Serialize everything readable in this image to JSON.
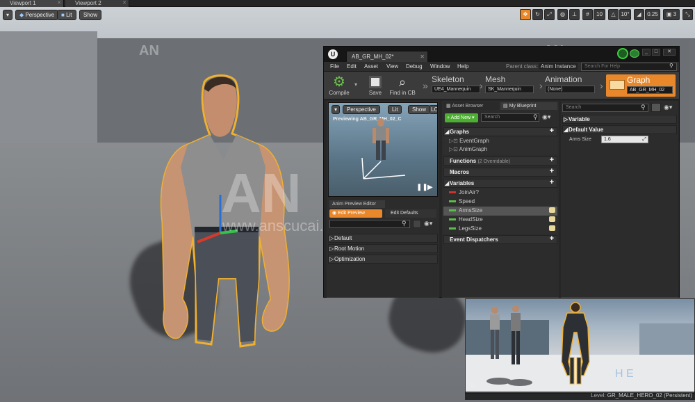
{
  "viewport_tabs": [
    "Viewport 1",
    "Viewport 2"
  ],
  "viewport_toolbar": {
    "perspective": "Perspective",
    "lit": "Lit",
    "show": "Show"
  },
  "viewport_settings": {
    "grid_snap": "10",
    "rot_snap": "10°",
    "scale_snap": "0.25",
    "camera_speed": "3"
  },
  "watermark": {
    "logo": "AN",
    "site": "www.anscucai.com"
  },
  "editor": {
    "doc_tab": "AB_GR_MH_02*",
    "menu": [
      "File",
      "Edit",
      "Asset",
      "View",
      "Debug",
      "Window",
      "Help"
    ],
    "parent_class_label": "Parent class:",
    "parent_class": "Anim Instance",
    "search_help": "Search For Help",
    "tools": {
      "compile": "Compile",
      "save": "Save",
      "find_in_cb": "Find in CB"
    },
    "breadcrumbs": [
      {
        "label": "Skeleton",
        "value": "UE4_Mannequin"
      },
      {
        "label": "Mesh",
        "value": "SK_Mannequin"
      },
      {
        "label": "Animation",
        "value": "(None)"
      },
      {
        "label": "Graph",
        "value": "AB_GR_MH_02"
      }
    ],
    "preview": {
      "perspective": "Perspective",
      "lit": "Lit",
      "show": "Show",
      "extra": "LO",
      "previewing": "Previewing AB_GR_MH_02_C",
      "anim_preview_editor": "Anim Preview Editor",
      "edit_preview": "Edit Preview",
      "edit_defaults": "Edit Defaults",
      "sections": [
        "Default",
        "Root Motion",
        "Optimization"
      ]
    },
    "my_blueprint": {
      "tabs": [
        "Asset Browser",
        "My Blueprint"
      ],
      "add_new": "Add New",
      "search_placeholder": "Search",
      "graphs_header": "Graphs",
      "graphs": [
        "EventGraph",
        "AnimGraph"
      ],
      "functions_header": "Functions",
      "functions_count": "(2 Overridable)",
      "macros_header": "Macros",
      "variables_header": "Variables",
      "variables": [
        "JoinAir?",
        "Speed",
        "ArmsSize",
        "HeadSize",
        "LegsSize"
      ],
      "dispatchers_header": "Event Dispatchers"
    },
    "details": {
      "search_placeholder": "Search",
      "variable_header": "Variable",
      "default_value_header": "Default Value",
      "property_label": "Arms Size",
      "property_value": "1.6"
    }
  },
  "status": {
    "level_label": "Level:",
    "level_name": "GR_MALE_HERO_02 (Persistent)"
  },
  "colors": {
    "accent_orange": "#e9882a",
    "add_green": "#4caf32",
    "selection_outline": "#f0b030"
  }
}
